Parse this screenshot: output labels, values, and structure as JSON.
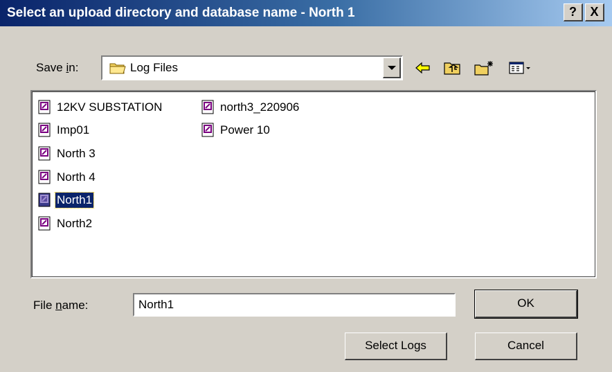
{
  "window": {
    "title": "Select an upload directory and database name - North 1",
    "help_label": "?",
    "close_label": "X"
  },
  "save_in": {
    "label_pre": "Save ",
    "label_mnemonic": "i",
    "label_post": "n:",
    "value": "Log Files"
  },
  "toolbar": {
    "icons": [
      "back-arrow-icon",
      "up-folder-icon",
      "new-folder-icon",
      "view-menu-icon"
    ]
  },
  "files": [
    {
      "name": "12KV SUBSTATION",
      "selected": false
    },
    {
      "name": "Imp01",
      "selected": false
    },
    {
      "name": "North 3",
      "selected": false
    },
    {
      "name": "North 4",
      "selected": false
    },
    {
      "name": "North1",
      "selected": true
    },
    {
      "name": "North2",
      "selected": false
    },
    {
      "name": "north3_220906",
      "selected": false
    },
    {
      "name": "Power 10",
      "selected": false
    }
  ],
  "filename": {
    "label_pre": "File ",
    "label_mnemonic": "n",
    "label_post": "ame:",
    "value": "North1"
  },
  "buttons": {
    "ok": "OK",
    "select_logs": "Select Logs",
    "cancel": "Cancel"
  },
  "colors": {
    "title_gradient_start": "#0a246a",
    "title_gradient_end": "#a6caf0",
    "selection": "#0a246a",
    "file_icon": "#7a0080"
  }
}
